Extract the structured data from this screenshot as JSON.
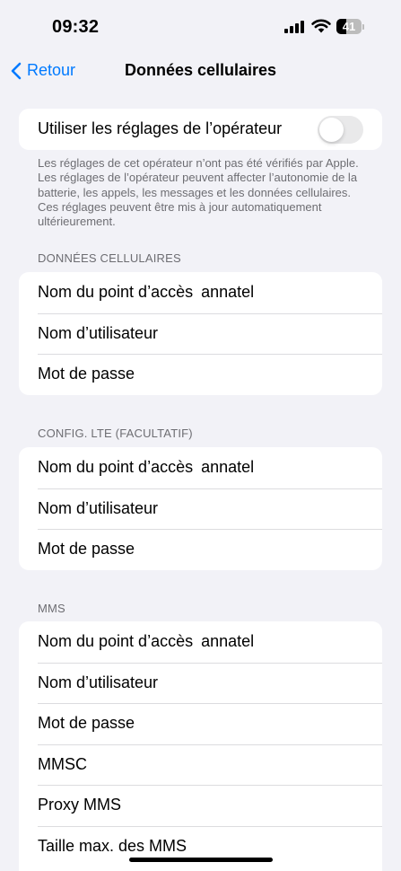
{
  "status_bar": {
    "time": "09:32",
    "battery": "41",
    "battery_level": 0.41
  },
  "nav": {
    "back_label": "Retour",
    "title": "Données cellulaires"
  },
  "carrier_settings": {
    "label": "Utiliser les réglages de l’opérateur",
    "enabled": false,
    "footnote": "Les réglages de cet opérateur n’ont pas été vérifiés par Apple. Les réglages de l’opérateur peuvent affecter l’autonomie de la batterie, les appels, les messages et les données cellulaires. Ces réglages peuvent être mis à jour automatiquement ultérieurement."
  },
  "sections": [
    {
      "header": "DONNÉES CELLULAIRES",
      "rows": [
        {
          "label": "Nom du point d’accès",
          "value": "annatel"
        },
        {
          "label": "Nom d’utilisateur",
          "value": ""
        },
        {
          "label": "Mot de passe",
          "value": ""
        }
      ]
    },
    {
      "header": "CONFIG. LTE (FACULTATIF)",
      "rows": [
        {
          "label": "Nom du point d’accès",
          "value": "annatel"
        },
        {
          "label": "Nom d’utilisateur",
          "value": ""
        },
        {
          "label": "Mot de passe",
          "value": ""
        }
      ]
    },
    {
      "header": "MMS",
      "rows": [
        {
          "label": "Nom du point d’accès",
          "value": "annatel"
        },
        {
          "label": "Nom d’utilisateur",
          "value": ""
        },
        {
          "label": "Mot de passe",
          "value": ""
        },
        {
          "label": "MMSC",
          "value": ""
        },
        {
          "label": "Proxy MMS",
          "value": ""
        },
        {
          "label": "Taille max. des MMS",
          "value": ""
        }
      ]
    }
  ],
  "colors": {
    "accent": "#007aff",
    "background": "#f2f2f7",
    "secondary_text": "#6d6d72"
  }
}
